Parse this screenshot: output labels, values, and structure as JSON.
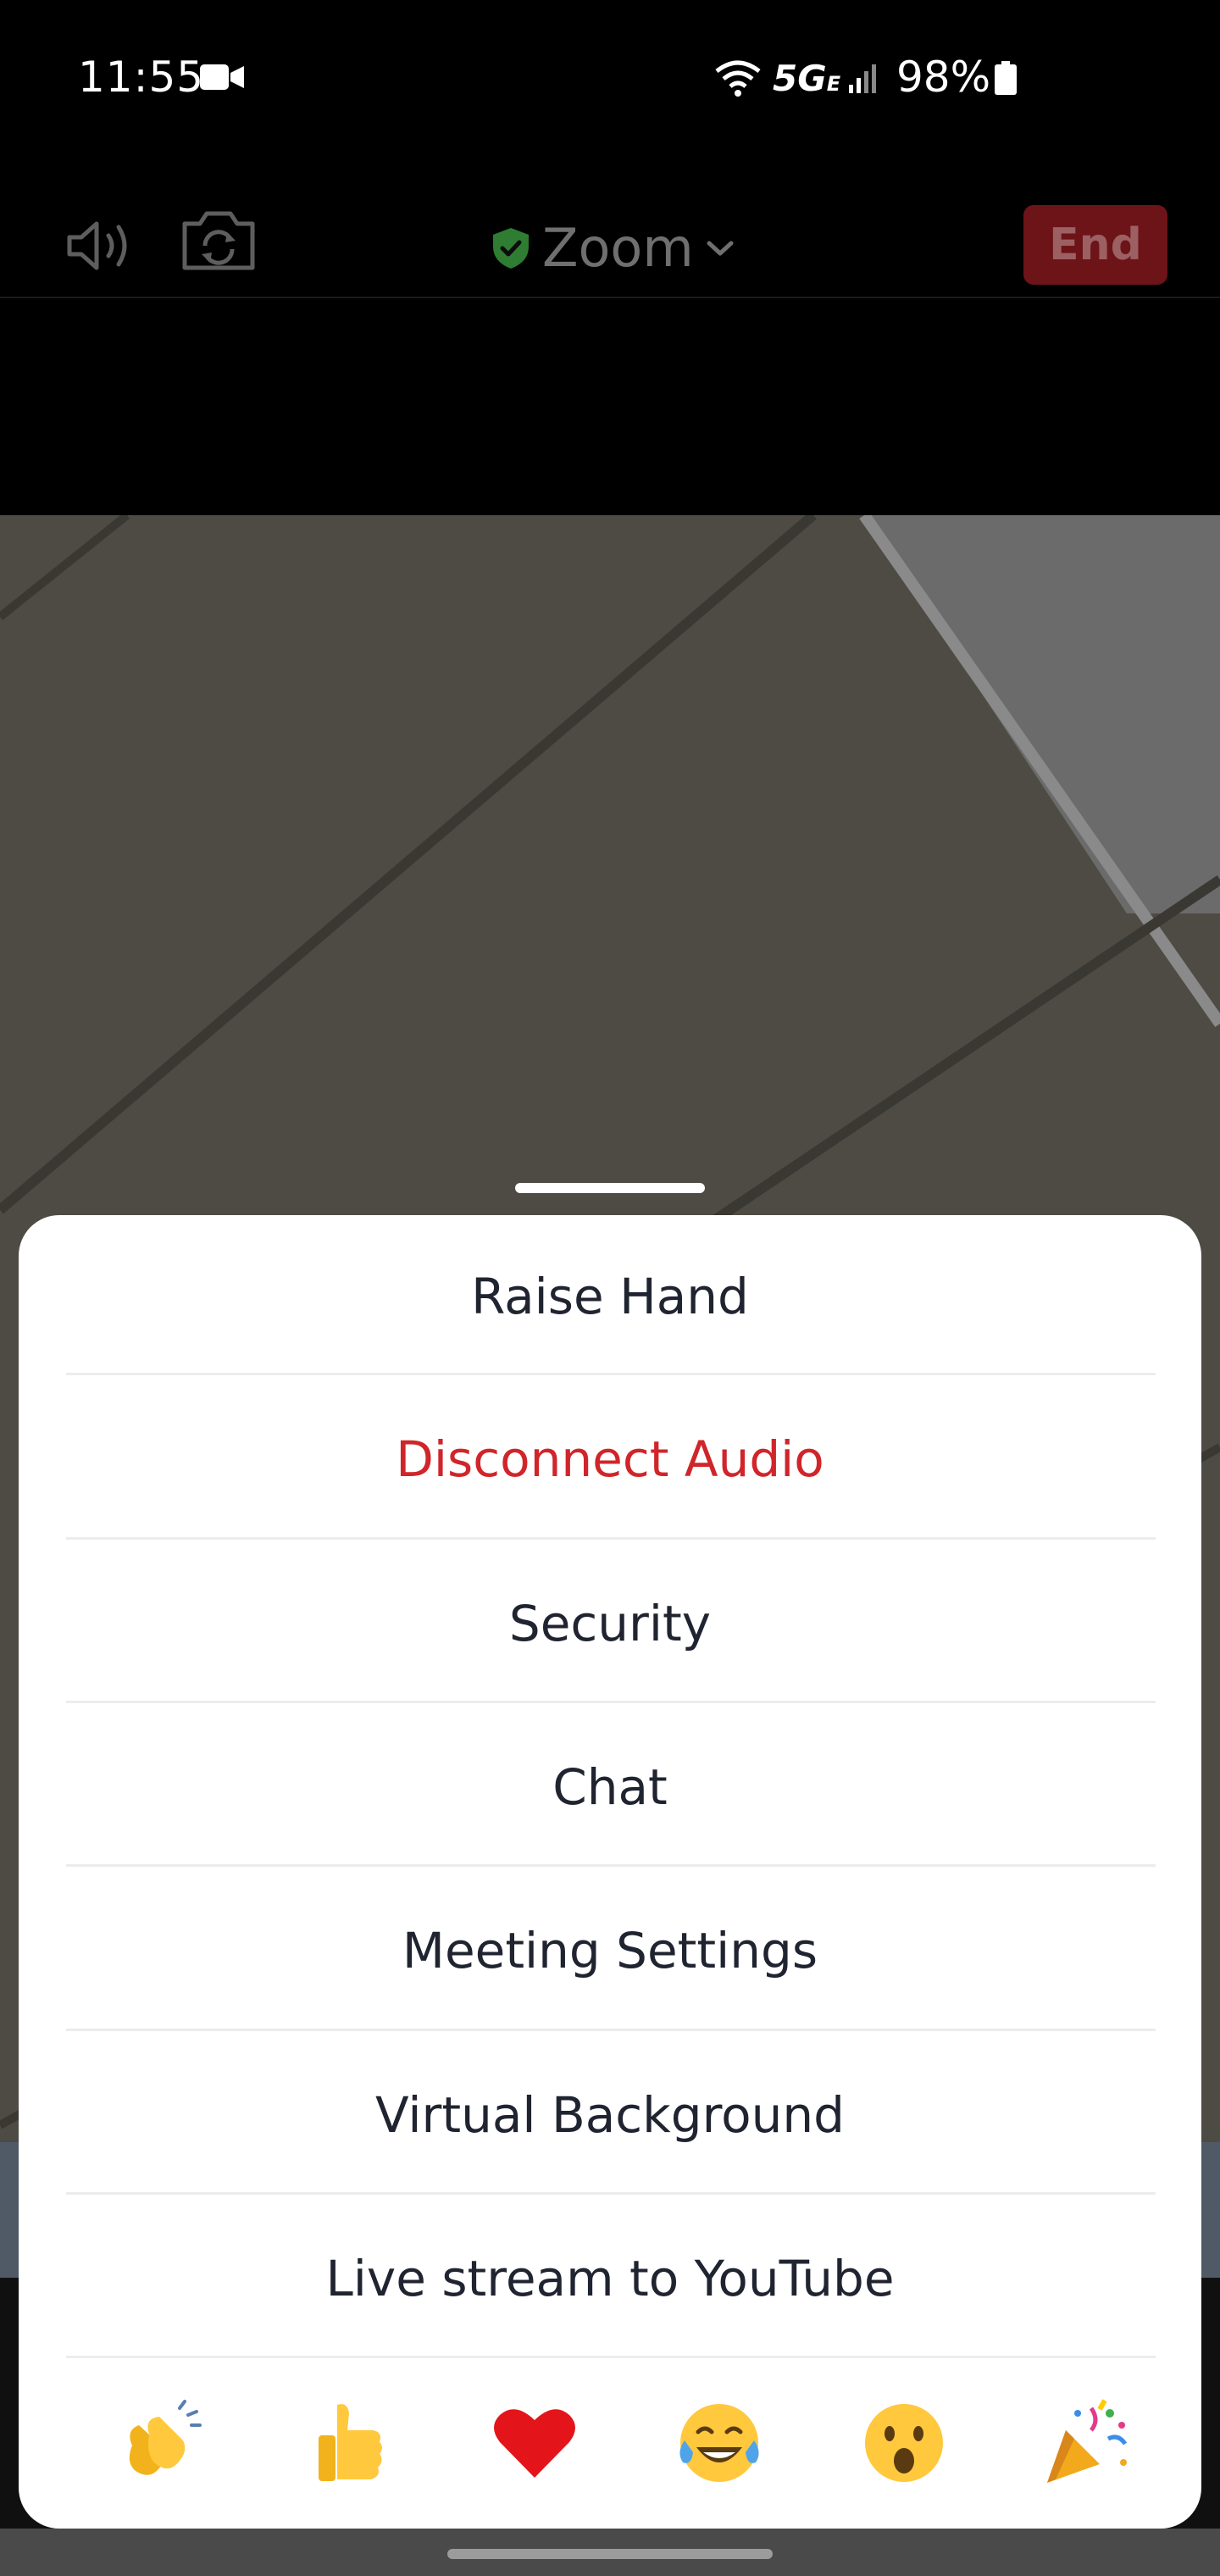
{
  "status_bar": {
    "time": "11:55",
    "network": "5G",
    "network_suffix": "E",
    "battery": "98%"
  },
  "meeting_header": {
    "title": "Zoom",
    "end_label": "End"
  },
  "menu": {
    "items": [
      {
        "label": "Raise Hand"
      },
      {
        "label": "Disconnect Audio"
      },
      {
        "label": "Security"
      },
      {
        "label": "Chat"
      },
      {
        "label": "Meeting Settings"
      },
      {
        "label": "Virtual Background"
      },
      {
        "label": "Live stream to YouTube"
      }
    ]
  },
  "reactions": [
    "clapping-hands",
    "thumbs-up",
    "red-heart",
    "tears-of-joy",
    "surprised-face",
    "party-popper"
  ],
  "colors": {
    "danger": "#d0252a",
    "end_button": "#6d1418",
    "shield": "#2e7d32"
  }
}
